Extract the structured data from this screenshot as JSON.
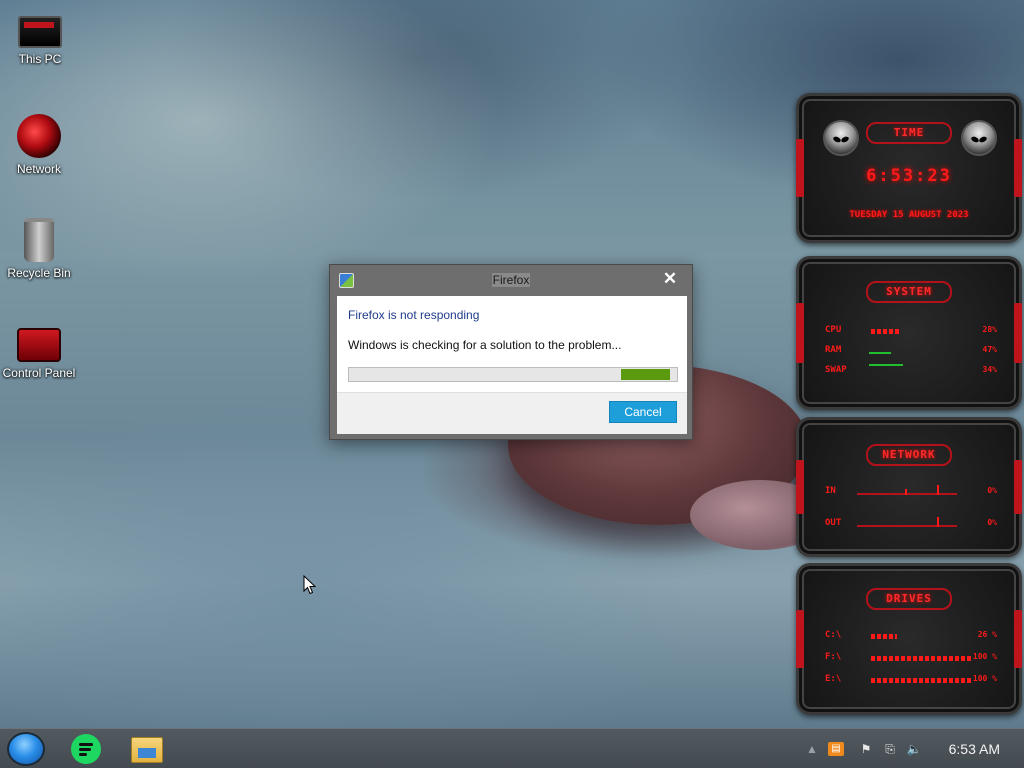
{
  "desktop": {
    "icons": [
      {
        "label": "This PC",
        "icon": "computer-icon"
      },
      {
        "label": "Network",
        "icon": "network-icon"
      },
      {
        "label": "Recycle Bin",
        "icon": "recycle-bin-icon"
      },
      {
        "label": "Control Panel",
        "icon": "control-panel-icon"
      }
    ]
  },
  "gadgets": {
    "time": {
      "title": "TIME",
      "clock": "6:53:23",
      "date": "TUESDAY 15 AUGUST 2023"
    },
    "system": {
      "title": "SYSTEM",
      "rows": [
        {
          "label": "CPU",
          "value": "28%",
          "level": 0.28
        },
        {
          "label": "RAM",
          "value": "47%",
          "level": 0.47
        },
        {
          "label": "SWAP",
          "value": "34%",
          "level": 0.34
        }
      ]
    },
    "network": {
      "title": "NETWORK",
      "rows": [
        {
          "label": "IN",
          "value": "0%"
        },
        {
          "label": "OUT",
          "value": "0%"
        }
      ]
    },
    "drives": {
      "title": "DRIVES",
      "rows": [
        {
          "label": "C:\\",
          "value": "26 %",
          "level": 0.26
        },
        {
          "label": "F:\\",
          "value": "100 %",
          "level": 1.0
        },
        {
          "label": "E:\\",
          "value": "100 %",
          "level": 1.0
        }
      ]
    }
  },
  "dialog": {
    "title": "Firefox",
    "close_glyph": "✕",
    "heading": "Firefox is not responding",
    "message": "Windows is checking for a solution to the problem...",
    "progress_segment": {
      "start": 0.83,
      "end": 0.98
    },
    "cancel_label": "Cancel"
  },
  "taskbar": {
    "apps": [
      "start-button",
      "spotify",
      "file-explorer"
    ],
    "tray_icons": [
      "show-hidden-icons-chevron",
      "orange-app-icon",
      "action-center-flag-icon",
      "network-icon",
      "volume-icon"
    ],
    "clock": "6:53 AM"
  },
  "colors": {
    "accent_red": "#ff1a1a",
    "dialog_heading": "#1f3c8a",
    "cancel_button": "#1f9fd9",
    "progress_green": "#5a9a0f"
  }
}
